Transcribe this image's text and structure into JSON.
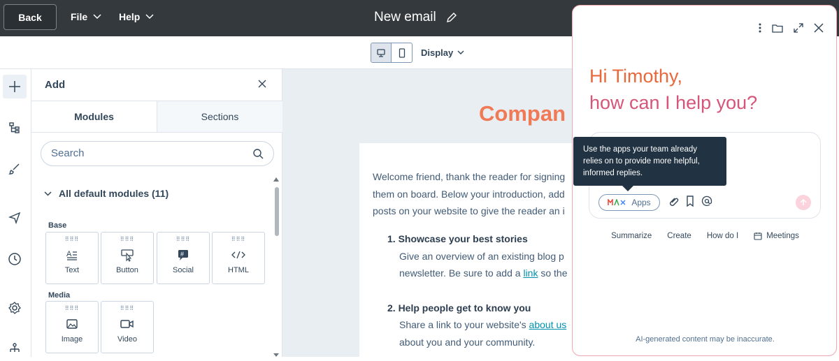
{
  "topbar": {
    "back_label": "Back",
    "file_label": "File",
    "help_label": "Help",
    "title": "New email"
  },
  "toolbar2": {
    "display_label": "Display"
  },
  "rail": {
    "items": [
      "add-icon",
      "structure-icon",
      "brush-icon",
      "send-icon",
      "clock-icon",
      "gear-icon",
      "tree-icon"
    ]
  },
  "add_panel": {
    "title": "Add",
    "tabs": [
      {
        "label": "Modules",
        "active": true
      },
      {
        "label": "Sections",
        "active": false
      }
    ],
    "search_placeholder": "Search",
    "section_title": "All default modules (11)",
    "groups": [
      {
        "label": "Base",
        "modules": [
          {
            "label": "Text",
            "icon": "text-icon"
          },
          {
            "label": "Button",
            "icon": "button-icon"
          },
          {
            "label": "Social",
            "icon": "social-icon"
          },
          {
            "label": "HTML",
            "icon": "html-icon"
          }
        ]
      },
      {
        "label": "Media",
        "modules": [
          {
            "label": "Image",
            "icon": "image-icon"
          },
          {
            "label": "Video",
            "icon": "video-icon"
          }
        ]
      }
    ]
  },
  "canvas": {
    "company": "Compan",
    "intro_lines": [
      "Welcome friend, thank the reader for signing",
      "them on board. Below your introduction, add",
      "posts on your website to give the reader an i"
    ],
    "item1_title": "1. Showcase your best stories",
    "item1_line1": "Give an overview of an existing blog p",
    "item1_line2_prefix": "newsletter. Be sure to add a ",
    "item1_link": "link",
    "item1_line2_suffix": " so the",
    "item2_title": "2. Help people get to know you",
    "item2_line1_prefix": "Share a link to your website's ",
    "item2_link": "about us",
    "item2_line2": "about you and your community."
  },
  "assistant": {
    "greeting_line1": "Hi Timothy,",
    "greeting_line2": "how can I help you?",
    "tooltip": "Use the apps your team already relies on to provide more helpful, informed replies.",
    "apps_label": "Apps",
    "quick_actions": [
      "Summarize",
      "Create",
      "How do I",
      "Meetings"
    ],
    "disclaimer": "AI-generated content may be inaccurate."
  },
  "colors": {
    "topbar": "#33393d",
    "greeting_orange": "#e9683c",
    "greeting_pink": "#d6567a",
    "company_orange": "#f07a55",
    "link": "#0091ae",
    "tooltip": "#213343"
  }
}
